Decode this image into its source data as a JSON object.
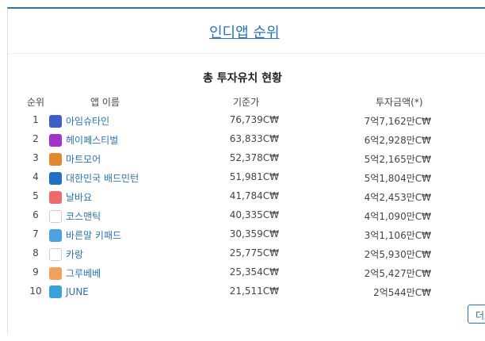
{
  "header": {
    "title": "인디앱 순위"
  },
  "section": {
    "subtitle": "총 투자유치 현황"
  },
  "table": {
    "columns": {
      "rank": "순위",
      "app": "앱 이름",
      "price": "기준가",
      "investment": "투자금액(*)"
    },
    "rows": [
      {
        "rank": "1",
        "name": "아임슈타인",
        "price": "76,739C₩",
        "investment": "7억7,162만C₩",
        "icon": "einstein-app-icon",
        "color": "#3b5fc4"
      },
      {
        "rank": "2",
        "name": "헤이페스티벌",
        "price": "63,833C₩",
        "investment": "6억2,928만C₩",
        "icon": "festival-app-icon",
        "color": "#a334c9"
      },
      {
        "rank": "3",
        "name": "마트모어",
        "price": "52,378C₩",
        "investment": "5억2,165만C₩",
        "icon": "martmore-app-icon",
        "color": "#e08a2c"
      },
      {
        "rank": "4",
        "name": "대한민국 배드민턴",
        "price": "51,981C₩",
        "investment": "5억1,804만C₩",
        "icon": "badminton-app-icon",
        "color": "#1f6fc9"
      },
      {
        "rank": "5",
        "name": "날바요",
        "price": "41,784C₩",
        "investment": "4억2,453만C₩",
        "icon": "nalbayo-app-icon",
        "color": "#f06a6a"
      },
      {
        "rank": "6",
        "name": "코스맨틱",
        "price": "40,335C₩",
        "investment": "4억1,090만C₩",
        "icon": "cosmantic-app-icon",
        "color": "#ffffff"
      },
      {
        "rank": "7",
        "name": "바른말 키패드",
        "price": "30,359C₩",
        "investment": "3억1,106만C₩",
        "icon": "keypad-app-icon",
        "color": "#4aa3e0"
      },
      {
        "rank": "8",
        "name": "카랑",
        "price": "25,775C₩",
        "investment": "2억5,930만C₩",
        "icon": "karang-app-icon",
        "color": "#ffffff"
      },
      {
        "rank": "9",
        "name": "그루베베",
        "price": "25,354C₩",
        "investment": "2억5,427만C₩",
        "icon": "groovebebe-app-icon",
        "color": "#f2a05a"
      },
      {
        "rank": "10",
        "name": "JUNE",
        "price": "21,511C₩",
        "investment": "2억544만C₩",
        "icon": "june-app-icon",
        "color": "#3aa0d8"
      }
    ]
  },
  "more": {
    "label": "더보기"
  }
}
